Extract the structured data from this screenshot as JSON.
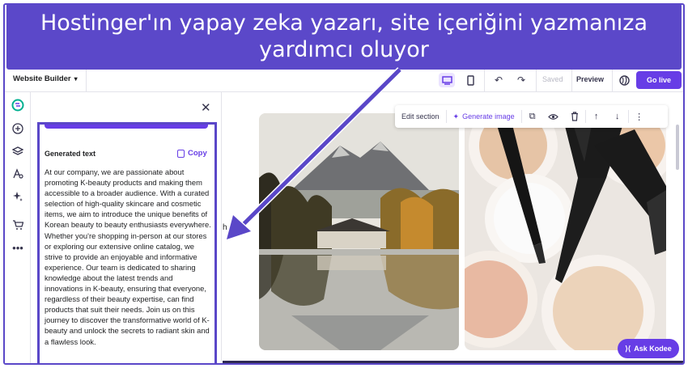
{
  "banner": {
    "caption": "Hostinger'ın yapay zeka yazarı, site içeriğini yazmanıza yardımcı oluyor"
  },
  "topbar": {
    "app_menu_label": "Website Builder",
    "saved_label": "Saved",
    "preview_label": "Preview",
    "go_live_label": "Go live"
  },
  "rail": {
    "icons": [
      "hostinger-logo-icon",
      "add-icon",
      "layers-icon",
      "styles-icon",
      "ai-sparkle-icon",
      "store-icon",
      "more-icon"
    ]
  },
  "panel": {
    "generated_heading": "Generated text",
    "copy_label": "Copy",
    "generated_text": "At our company, we are passionate about promoting K-beauty products and making them accessible to a broader audience. With a curated selection of high-quality skincare and cosmetic items, we aim to introduce the unique benefits of Korean beauty to beauty enthusiasts everywhere. Whether you're shopping in-person at our stores or exploring our extensive online catalog, we strive to provide an enjoyable and informative experience. Our team is dedicated to sharing knowledge about the latest trends and innovations in K-beauty, ensuring that everyone, regardless of their beauty expertise, can find products that suit their needs. Join us on this journey to discover the transformative world of K-beauty and unlock the secrets to radiant skin and a flawless look."
  },
  "canvas": {
    "partial_text": "hat",
    "section_toolbar": {
      "edit_label": "Edit section",
      "generate_label": "Generate image"
    },
    "ask_kodee_label": "Ask Kodee"
  },
  "colors": {
    "accent": "#673de6",
    "banner": "#5b48c9",
    "annotation": "#5a47c8"
  }
}
